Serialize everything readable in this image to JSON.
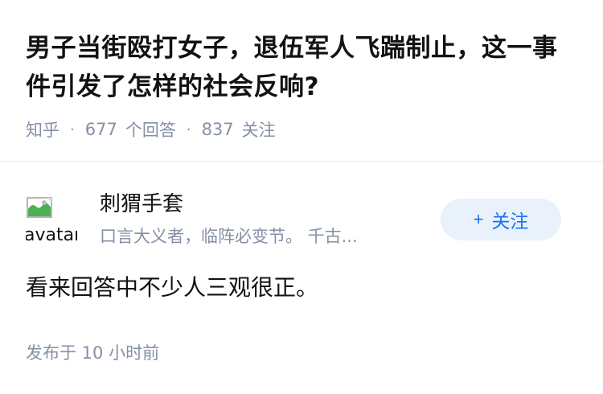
{
  "question": {
    "title": "男子当街殴打女子，退伍军人飞踹制止，这一事件引发了怎样的社会反响?",
    "source": "知乎",
    "separator": "·",
    "answer_count": "677",
    "answer_label": "个回答",
    "follower_count": "837",
    "follower_label": "关注"
  },
  "answer": {
    "author": {
      "avatar_alt": "avatar",
      "name": "刺猬手套",
      "bio": "口言大义者，临阵必变节。 千古..."
    },
    "follow_button": {
      "icon": "+",
      "label": "关注"
    },
    "content": "看来回答中不少人三观很正。",
    "published": "发布于  10 小时前"
  },
  "colors": {
    "text_primary": "#121212",
    "text_secondary": "#8590a6",
    "accent": "#1772f6",
    "button_bg": "#e9f1fb"
  }
}
